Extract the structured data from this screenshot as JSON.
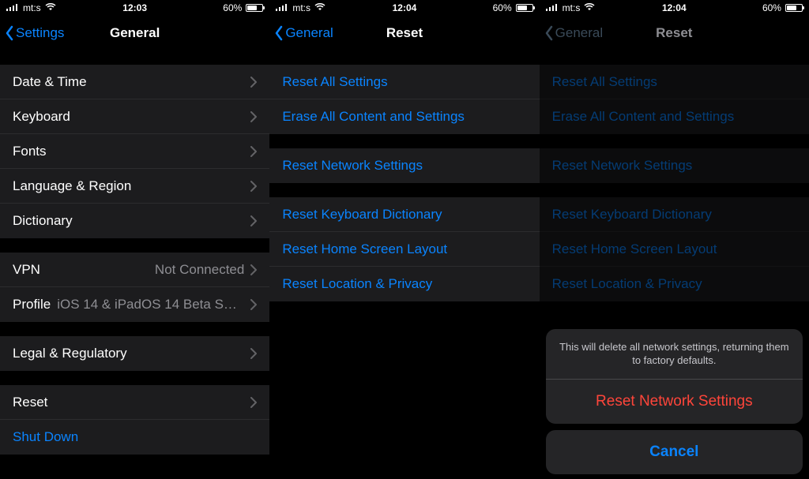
{
  "colors": {
    "accent": "#0a84ff",
    "destructive": "#ff453a"
  },
  "panels": [
    {
      "status": {
        "carrier": "mt:s",
        "time": "12:03",
        "battery": "60%"
      },
      "nav": {
        "back": "Settings",
        "title": "General"
      },
      "groups": [
        {
          "rows": [
            {
              "label": "Date & Time",
              "disclosure": true
            },
            {
              "label": "Keyboard",
              "disclosure": true
            },
            {
              "label": "Fonts",
              "disclosure": true
            },
            {
              "label": "Language & Region",
              "disclosure": true
            },
            {
              "label": "Dictionary",
              "disclosure": true
            }
          ]
        },
        {
          "rows": [
            {
              "label": "VPN",
              "value": "Not Connected",
              "disclosure": true
            },
            {
              "label": "Profile",
              "value": "iOS 14 & iPadOS 14 Beta Softwar...",
              "disclosure": true
            }
          ]
        },
        {
          "rows": [
            {
              "label": "Legal & Regulatory",
              "disclosure": true
            }
          ]
        },
        {
          "rows": [
            {
              "label": "Reset",
              "disclosure": true
            },
            {
              "label": "Shut Down",
              "link": true
            }
          ]
        }
      ]
    },
    {
      "status": {
        "carrier": "mt:s",
        "time": "12:04",
        "battery": "60%"
      },
      "nav": {
        "back": "General",
        "title": "Reset"
      },
      "groups": [
        {
          "rows": [
            {
              "label": "Reset All Settings",
              "link": true
            },
            {
              "label": "Erase All Content and Settings",
              "link": true
            }
          ]
        },
        {
          "rows": [
            {
              "label": "Reset Network Settings",
              "link": true
            }
          ]
        },
        {
          "rows": [
            {
              "label": "Reset Keyboard Dictionary",
              "link": true
            },
            {
              "label": "Reset Home Screen Layout",
              "link": true
            },
            {
              "label": "Reset Location & Privacy",
              "link": true
            }
          ]
        }
      ]
    },
    {
      "status": {
        "carrier": "mt:s",
        "time": "12:04",
        "battery": "60%"
      },
      "nav": {
        "back": "General",
        "title": "Reset",
        "dim": true
      },
      "groups": [
        {
          "rows": [
            {
              "label": "Reset All Settings",
              "link": true
            },
            {
              "label": "Erase All Content and Settings",
              "link": true
            }
          ]
        },
        {
          "rows": [
            {
              "label": "Reset Network Settings",
              "link": true
            }
          ]
        },
        {
          "rows": [
            {
              "label": "Reset Keyboard Dictionary",
              "link": true
            },
            {
              "label": "Reset Home Screen Layout",
              "link": true
            },
            {
              "label": "Reset Location & Privacy",
              "link": true
            }
          ]
        }
      ],
      "sheet": {
        "message": "This will delete all network settings, returning them to factory defaults.",
        "destructive": "Reset Network Settings",
        "cancel": "Cancel"
      }
    }
  ]
}
